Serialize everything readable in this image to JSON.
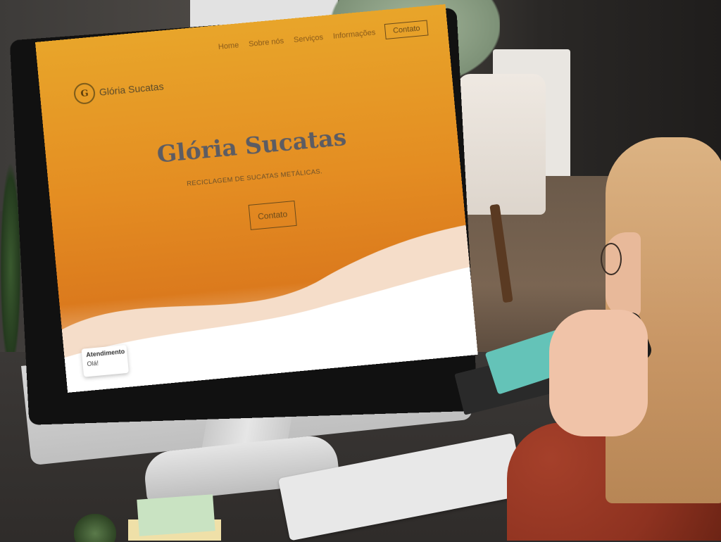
{
  "website": {
    "logo_letter": "G",
    "logo_text": "Glória Sucatas",
    "nav": [
      "Home",
      "Sobre nós",
      "Serviços",
      "Informações"
    ],
    "nav_contact": "Contato",
    "hero_title": "Glória Sucatas",
    "hero_subtitle": "RECICLAGEM DE SUCATAS METÁLICAS.",
    "hero_button": "Contato",
    "chat_title": "Atendimento",
    "chat_message": "Olá!"
  },
  "colors": {
    "hero_gradient_top": "#e8a52a",
    "hero_gradient_bottom": "#db7a1d",
    "title": "#5c5c63",
    "whatsapp": "#25d366"
  }
}
